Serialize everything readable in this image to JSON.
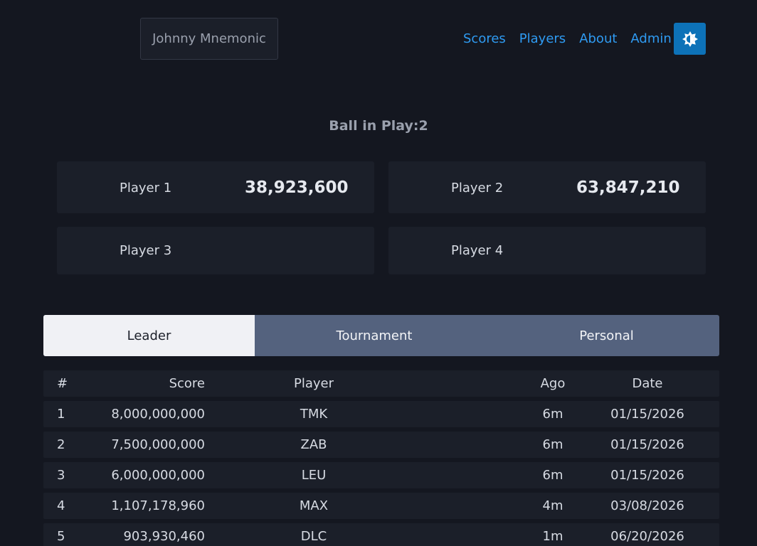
{
  "header": {
    "game_title": "Johnny Mnemonic",
    "nav": [
      "Scores",
      "Players",
      "About",
      "Admin"
    ],
    "theme_icon": "brightness-icon",
    "accent_color": "#2f9bf2",
    "theme_button_color": "#0d72b8"
  },
  "game": {
    "ball_in_play_label": "Ball in Play:2",
    "players": [
      {
        "name": "Player 1",
        "score": "38,923,600"
      },
      {
        "name": "Player 2",
        "score": "63,847,210"
      },
      {
        "name": "Player 3",
        "score": ""
      },
      {
        "name": "Player 4",
        "score": ""
      }
    ]
  },
  "tabs": {
    "items": [
      "Leader",
      "Tournament",
      "Personal"
    ],
    "active": "Leader"
  },
  "leaderboard": {
    "columns": [
      "#",
      "Score",
      "Player",
      "Ago",
      "Date"
    ],
    "rows": [
      {
        "rank": "1",
        "score": "8,000,000,000",
        "player": "TMK",
        "ago": "6m",
        "date": "01/15/2026"
      },
      {
        "rank": "2",
        "score": "7,500,000,000",
        "player": "ZAB",
        "ago": "6m",
        "date": "01/15/2026"
      },
      {
        "rank": "3",
        "score": "6,000,000,000",
        "player": "LEU",
        "ago": "6m",
        "date": "01/15/2026"
      },
      {
        "rank": "4",
        "score": "1,107,178,960",
        "player": "MAX",
        "ago": "4m",
        "date": "03/08/2026"
      },
      {
        "rank": "5",
        "score": "903,930,460",
        "player": "DLC",
        "ago": "1m",
        "date": "06/20/2026"
      }
    ]
  }
}
